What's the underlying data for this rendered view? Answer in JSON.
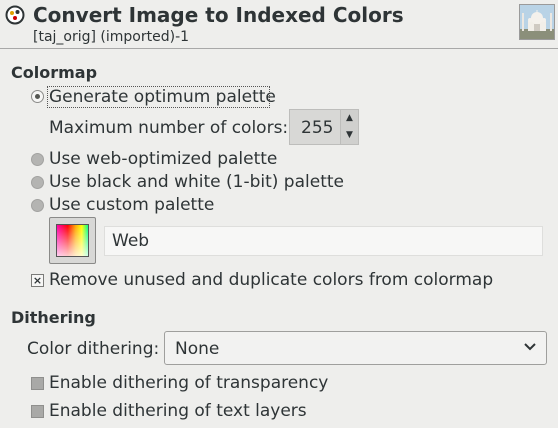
{
  "header": {
    "title": "Convert Image to Indexed Colors",
    "subtitle": "[taj_orig] (imported)-1"
  },
  "colormap": {
    "section_title": "Colormap",
    "generate_optimum_label": "Generate optimum palette",
    "max_colors_label": "Maximum number of colors:",
    "max_colors_value": "255",
    "web_optimized_label": "Use web-optimized palette",
    "black_white_label": "Use black and white (1-bit) palette",
    "custom_palette_label": "Use custom palette",
    "custom_palette_name": "Web",
    "remove_unused_label": "Remove unused and duplicate colors from colormap",
    "selected_option": "generate_optimum",
    "remove_unused_checked": true
  },
  "dithering": {
    "section_title": "Dithering",
    "color_dithering_label": "Color dithering:",
    "color_dithering_value": "None",
    "transparency_label": "Enable dithering of transparency",
    "text_layers_label": "Enable dithering of text layers",
    "transparency_checked": false,
    "text_layers_checked": false
  },
  "icons": {
    "logo": "gimp-logo-icon",
    "thumbnail": "image-thumbnail",
    "spin_up": "chevron-up-icon",
    "spin_down": "chevron-down-icon",
    "combo_arrow": "chevron-down-icon",
    "palette": "palette-icon"
  }
}
